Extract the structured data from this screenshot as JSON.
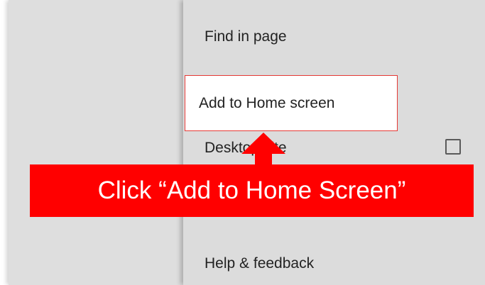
{
  "menu": {
    "items": [
      {
        "label": "Find in page"
      },
      {
        "label": "Add to Home screen"
      },
      {
        "label": "Desktop site",
        "checked": false
      },
      {
        "label": "Help & feedback"
      }
    ]
  },
  "callout": {
    "text": "Click “Add to Home Screen”",
    "color": "#ff0000",
    "arrow_color": "#ff0000"
  },
  "highlight": {
    "border_color": "#e53935"
  }
}
